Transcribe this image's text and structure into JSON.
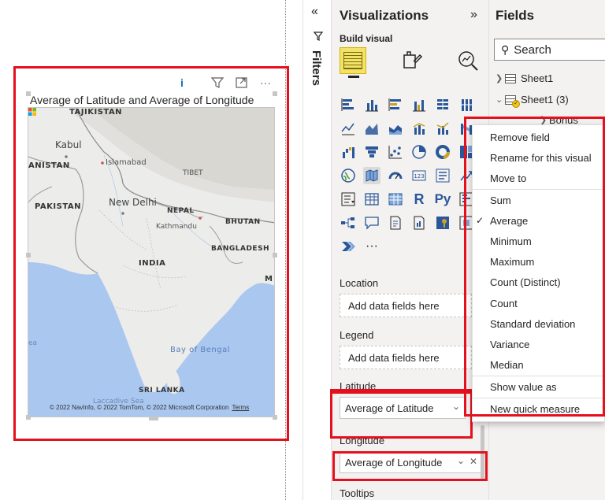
{
  "visual": {
    "title": "Average of Latitude and Average of Longitude",
    "toolbar": {
      "info": "i",
      "filter": "filter-icon",
      "focus": "focus-mode-icon",
      "more": "···"
    },
    "map_labels": {
      "tajikistan": "TAJIKISTAN",
      "kabul": "Kabul",
      "afghanistan": "ANISTAN",
      "islamabad": "Islamabad",
      "tibet": "TIBET",
      "pakistan": "PAKISTAN",
      "new_delhi": "New Delhi",
      "nepal": "NEPAL",
      "kathmandu": "Kathmandu",
      "bhutan": "BHUTAN",
      "bangladesh": "BANGLADESH",
      "india": "INDIA",
      "m": "M",
      "sea": "ea",
      "bay_of_bengal": "Bay of Bengal",
      "sri_lanka": "SRI LANKA",
      "laccadive": "Laccadive Sea"
    },
    "credit": "© 2022 NavInfo, © 2022 TomTom, © 2022 Microsoft Corporation",
    "terms": "Terms"
  },
  "filters": {
    "label": "Filters",
    "collapse": "«",
    "funnel": "filter-icon"
  },
  "visualizations": {
    "title": "Visualizations",
    "expand": "»",
    "build_visual": "Build visual",
    "more_visuals": "···",
    "r_label": "R",
    "py_label": "Py",
    "kpi_label": "123",
    "sections": {
      "location": {
        "label": "Location",
        "placeholder": "Add data fields here"
      },
      "legend": {
        "label": "Legend",
        "placeholder": "Add data fields here"
      },
      "latitude": {
        "label": "Latitude",
        "field": "Average of Latitude"
      },
      "longitude": {
        "label": "Longitude",
        "field": "Average of Longitude"
      },
      "tooltips": {
        "label": "Tooltips"
      }
    }
  },
  "fields": {
    "title": "Fields",
    "expand": "»",
    "search_placeholder": "Search",
    "tables": [
      {
        "name": "Sheet1",
        "expanded": false
      },
      {
        "name": "Sheet1 (3)",
        "expanded": true
      }
    ],
    "child_field": "Bonus"
  },
  "context_menu": {
    "items": [
      "Remove field",
      "Rename for this visual",
      "Move to",
      "Sum",
      "Average",
      "Minimum",
      "Maximum",
      "Count (Distinct)",
      "Count",
      "Standard deviation",
      "Variance",
      "Median",
      "Show value as",
      "New quick measure"
    ],
    "checked": "Average"
  },
  "colors": {
    "highlight": "#e5101d",
    "pane_bg": "#f3f2f1",
    "accent_yellow": "#f2c811",
    "water": "#aac7f0",
    "land": "#ececea"
  }
}
